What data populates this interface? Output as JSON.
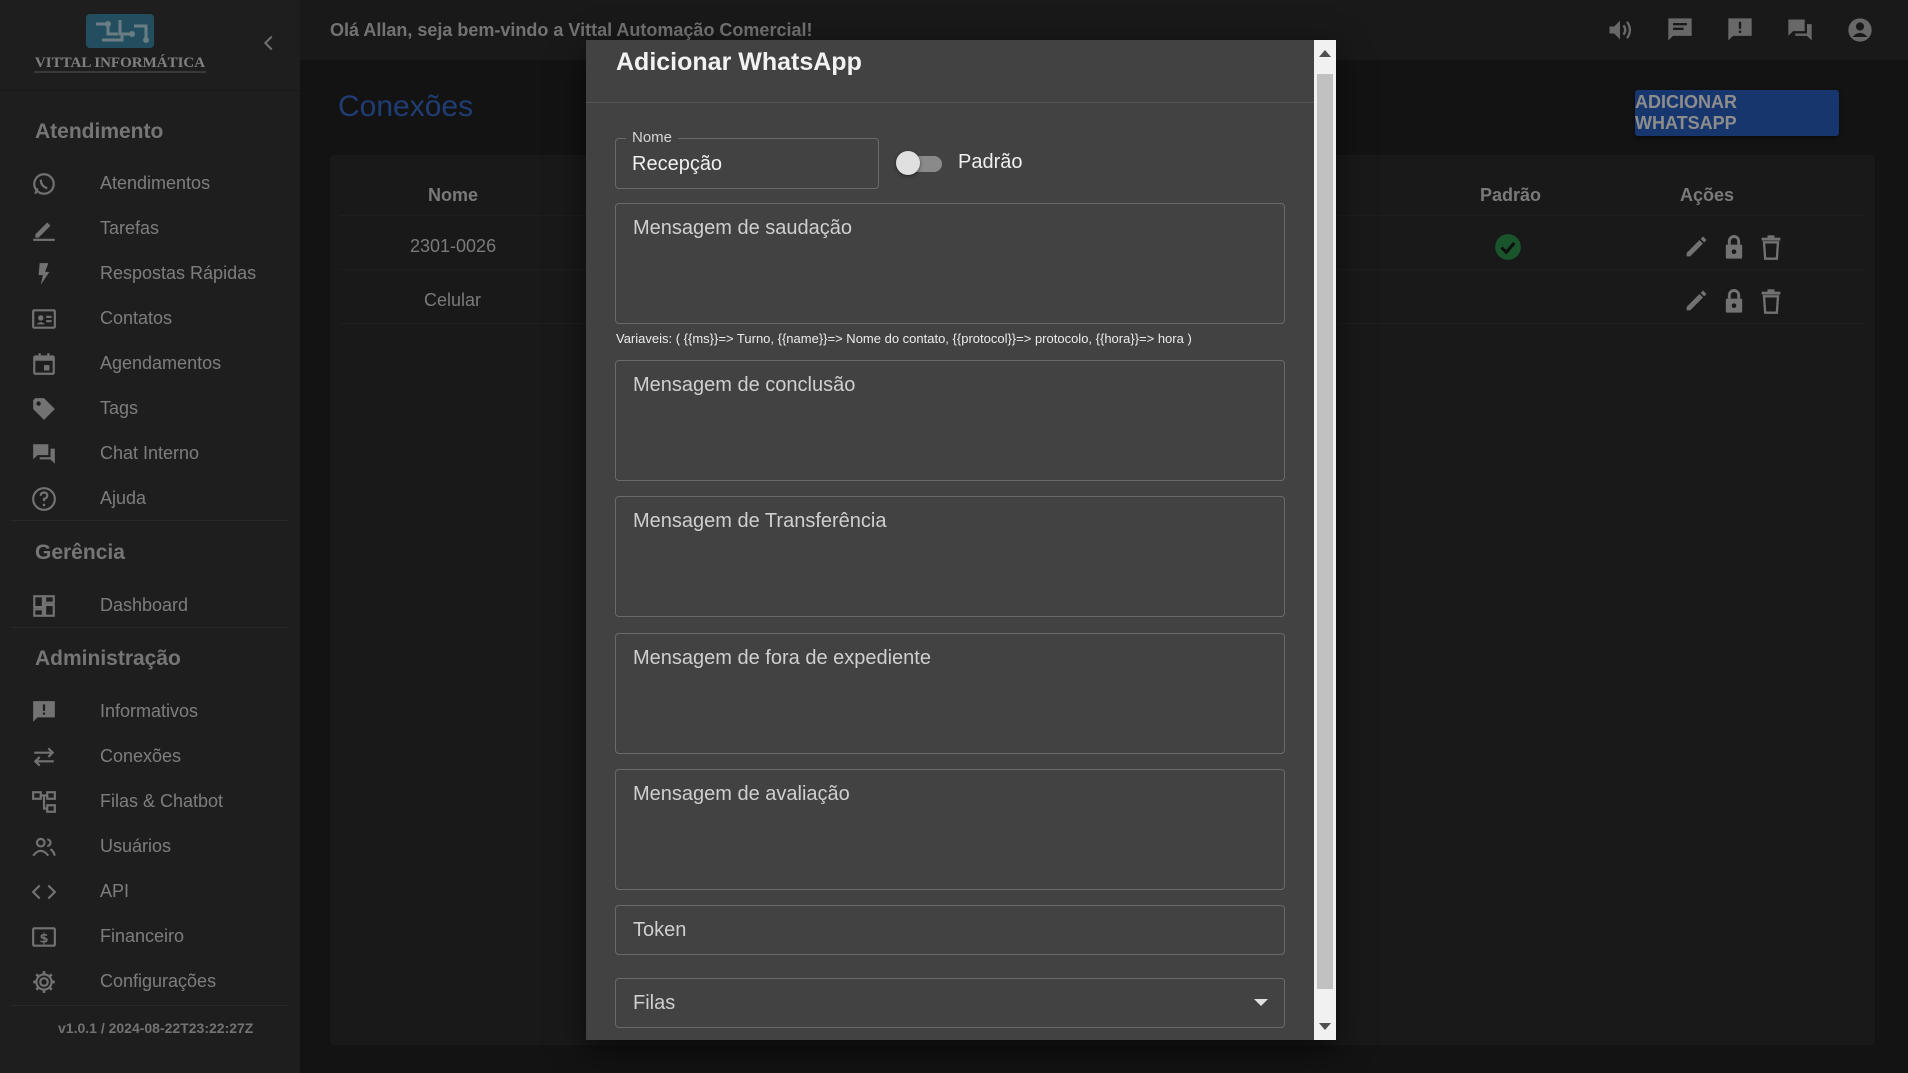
{
  "app": {
    "logo_text": "VITTAL INFORMÁTICA",
    "version": "v1.0.1 / 2024-08-22T23:22:27Z"
  },
  "topbar": {
    "welcome": "Olá Allan, seja bem-vindo a Vittal Automação Comercial!",
    "icons": [
      "volume-icon",
      "chat-icon",
      "announcement-icon",
      "forum-icon",
      "account-icon"
    ]
  },
  "sidebar": {
    "sections": {
      "atendimento": "Atendimento",
      "gerencia": "Gerência",
      "administracao": "Administração"
    },
    "items": [
      {
        "label": "Atendimentos",
        "icon": "whatsapp-icon"
      },
      {
        "label": "Tarefas",
        "icon": "pencil-icon"
      },
      {
        "label": "Respostas Rápidas",
        "icon": "flash-icon"
      },
      {
        "label": "Contatos",
        "icon": "contact-card-icon"
      },
      {
        "label": "Agendamentos",
        "icon": "calendar-icon"
      },
      {
        "label": "Tags",
        "icon": "tag-icon"
      },
      {
        "label": "Chat Interno",
        "icon": "forum-icon"
      },
      {
        "label": "Ajuda",
        "icon": "help-icon"
      },
      {
        "label": "Dashboard",
        "icon": "dashboard-icon"
      },
      {
        "label": "Informativos",
        "icon": "announcement-icon"
      },
      {
        "label": "Conexões",
        "icon": "swap-icon"
      },
      {
        "label": "Filas & Chatbot",
        "icon": "account-tree-icon"
      },
      {
        "label": "Usuários",
        "icon": "people-icon"
      },
      {
        "label": "API",
        "icon": "code-icon"
      },
      {
        "label": "Financeiro",
        "icon": "money-icon"
      },
      {
        "label": "Configurações",
        "icon": "gear-icon"
      }
    ]
  },
  "main": {
    "title": "Conexões",
    "add_button": "ADICIONAR WHATSAPP",
    "table": {
      "columns": {
        "nome": "Nome",
        "padrao": "Padrão",
        "acoes": "Ações"
      },
      "rows": [
        {
          "nome": "2301-0026",
          "padrao": true
        },
        {
          "nome": "Celular",
          "padrao": false
        }
      ]
    }
  },
  "modal": {
    "title": "Adicionar WhatsApp",
    "name_label": "Nome",
    "name_value": "Recepção",
    "default_switch_label": "Padrão",
    "default_switch_on": false,
    "greeting_placeholder": "Mensagem de saudação",
    "variables_hint": "Variaveis: ( {{ms}}=> Turno, {{name}}=> Nome do contato, {{protocol}}=> protocolo, {{hora}}=> hora )",
    "completion_placeholder": "Mensagem de conclusão",
    "transfer_placeholder": "Mensagem de Transferência",
    "out_of_hours_placeholder": "Mensagem de fora de expediente",
    "rating_placeholder": "Mensagem de avaliação",
    "token_placeholder": "Token",
    "queues_placeholder": "Filas"
  }
}
